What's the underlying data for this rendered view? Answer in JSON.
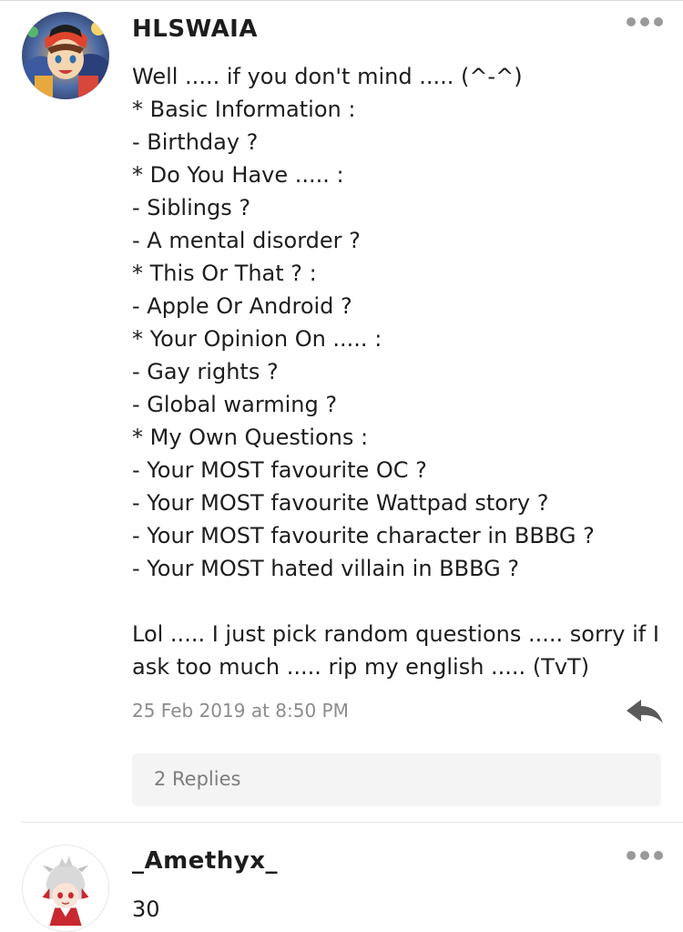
{
  "comments": [
    {
      "username": "HLSWAIA",
      "avatar_icon": "anime-character-avatar",
      "lines": [
        "Well ..... if you don't mind ..... (^-^)",
        "* Basic Information :",
        "- Birthday ?",
        "* Do You Have ..... :",
        "- Siblings ?",
        "- A mental disorder ?",
        "* This Or That ? :",
        "- Apple Or Android ?",
        "* Your Opinion On ..... :",
        "- Gay rights ?",
        "- Global warming ?",
        "* My Own Questions :",
        "- Your MOST favourite OC ?",
        "- Your MOST favourite Wattpad story ?",
        "- Your MOST favourite character in BBBG ?",
        "- Your MOST hated villain in BBBG ?",
        "",
        "Lol ..... I just pick random questions ..... sorry if I",
        "ask too much ..... rip my english ..... (TvT)"
      ],
      "timestamp": "25 Feb 2019 at 8:50 PM",
      "replies_label": "2 Replies",
      "more_icon": "more-dots-icon",
      "reply_icon": "reply-arrow-icon"
    },
    {
      "username": "_Amethyx_",
      "avatar_icon": "anime-character-avatar",
      "lines": [
        "30"
      ],
      "more_icon": "more-dots-icon"
    }
  ],
  "colors": {
    "text": "#1d1d1d",
    "muted": "#8c8c8c",
    "dots": "#9a9a9a",
    "reply_arrow": "#5a5a5a",
    "replies_bg": "#f4f4f4"
  }
}
